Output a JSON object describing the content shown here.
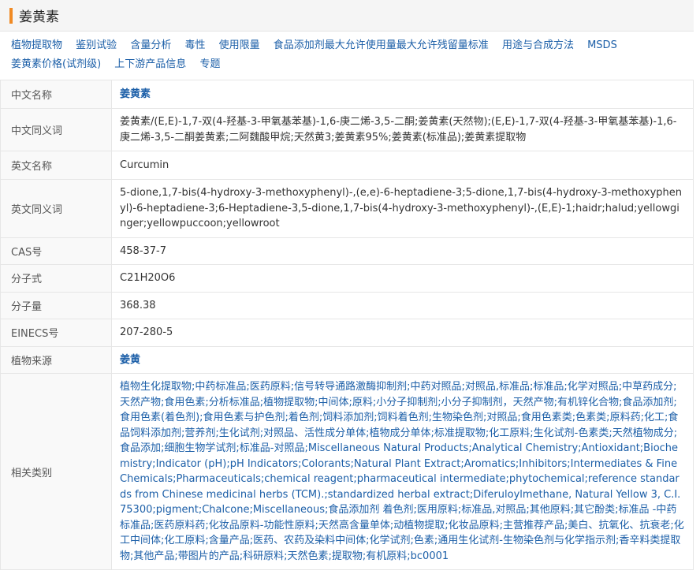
{
  "title": "姜黄素",
  "nav": [
    "植物提取物",
    "鉴别试验",
    "含量分析",
    "毒性",
    "使用限量",
    "食品添加剂最大允许使用量最大允许残留量标准",
    "用途与合成方法",
    "MSDS",
    "姜黄素价格(试剂级)",
    "上下游产品信息",
    "专题"
  ],
  "rows": {
    "cn_name": {
      "label": "中文名称",
      "value": "姜黄素"
    },
    "cn_synonyms": {
      "label": "中文同义词",
      "value": "姜黄素/(E,E)-1,7-双(4-羟基-3-甲氧基苯基)-1,6-庚二烯-3,5-二酮;姜黄素(天然物);(E,E)-1,7-双(4-羟基-3-甲氧基苯基)-1,6-庚二烯-3,5-二酮姜黄素;二阿魏酸甲烷;天然黄3;姜黄素95%;姜黄素(标准品);姜黄素提取物"
    },
    "en_name": {
      "label": "英文名称",
      "value": "Curcumin"
    },
    "en_synonyms": {
      "label": "英文同义词",
      "value": "5-dione,1,7-bis(4-hydroxy-3-methoxyphenyl)-,(e,e)-6-heptadiene-3;5-dione,1,7-bis(4-hydroxy-3-methoxyphenyl)-6-heptadiene-3;6-Heptadiene-3,5-dione,1,7-bis(4-hydroxy-3-methoxyphenyl)-,(E,E)-1;haidr;halud;yellowginger;yellowpuccoon;yellowroot"
    },
    "cas": {
      "label": "CAS号",
      "value": "458-37-7"
    },
    "formula": {
      "label": "分子式",
      "value": "C21H20O6"
    },
    "mw": {
      "label": "分子量",
      "value": "368.38"
    },
    "einecs": {
      "label": "EINECS号",
      "value": "207-280-5"
    },
    "source": {
      "label": "植物来源",
      "value": "姜黄"
    },
    "categories": {
      "label": "相关类别",
      "value": "植物生化提取物;中药标准品;医药原料;信号转导通路激酶抑制剂;中药对照品;对照品,标准品;标准品;化学对照品;中草药成分;天然产物;食用色素;分析标准品;植物提取物;中间体;原料;小分子抑制剂;小分子抑制剂，天然产物;有机锌化合物;食品添加剂;食用色素(着色剂);食用色素与护色剂;着色剂;饲料添加剂;饲料着色剂;生物染色剂;对照品;食用色素类;色素类;原料药;化工;食品饲料添加剂;营养剂;生化试剂;对照品、活性成分单体;植物成分单体;标准提取物;化工原料;生化试剂-色素类;天然植物成分;食品添加;细胞生物学试剂;标准品-对照品;Miscellaneous Natural Products;Analytical Chemistry;Antioxidant;Biochemistry;Indicator (pH);pH Indicators;Colorants;Natural Plant Extract;Aromatics;Inhibitors;Intermediates & Fine Chemicals;Pharmaceuticals;chemical reagent;pharmaceutical intermediate;phytochemical;reference standards from Chinese medicinal herbs (TCM).;standardized herbal extract;Diferuloylmethane, Natural Yellow 3, C.I. 75300;pigment;Chalcone;Miscellaneous;食品添加剂 着色剂;医用原料;标准品,对照品;其他原料;其它酚类;标准品 -中药标准品;医药原料药;化妆品原料-功能性原料;天然高含量单体;动植物提取;化妆品原料;主营推荐产品;美白、抗氧化、抗衰老;化工中间体;化工原料;含量产品;医药、农药及染料中间体;化学试剂;色素;通用生化试剂-生物染色剂与化学指示剂;香辛料类提取物;其他产品;带图片的产品;科研原料;天然色素;提取物;有机原料;bc0001"
    }
  },
  "colors": {
    "link": "#1c5fa8",
    "accent": "#f08a24"
  }
}
